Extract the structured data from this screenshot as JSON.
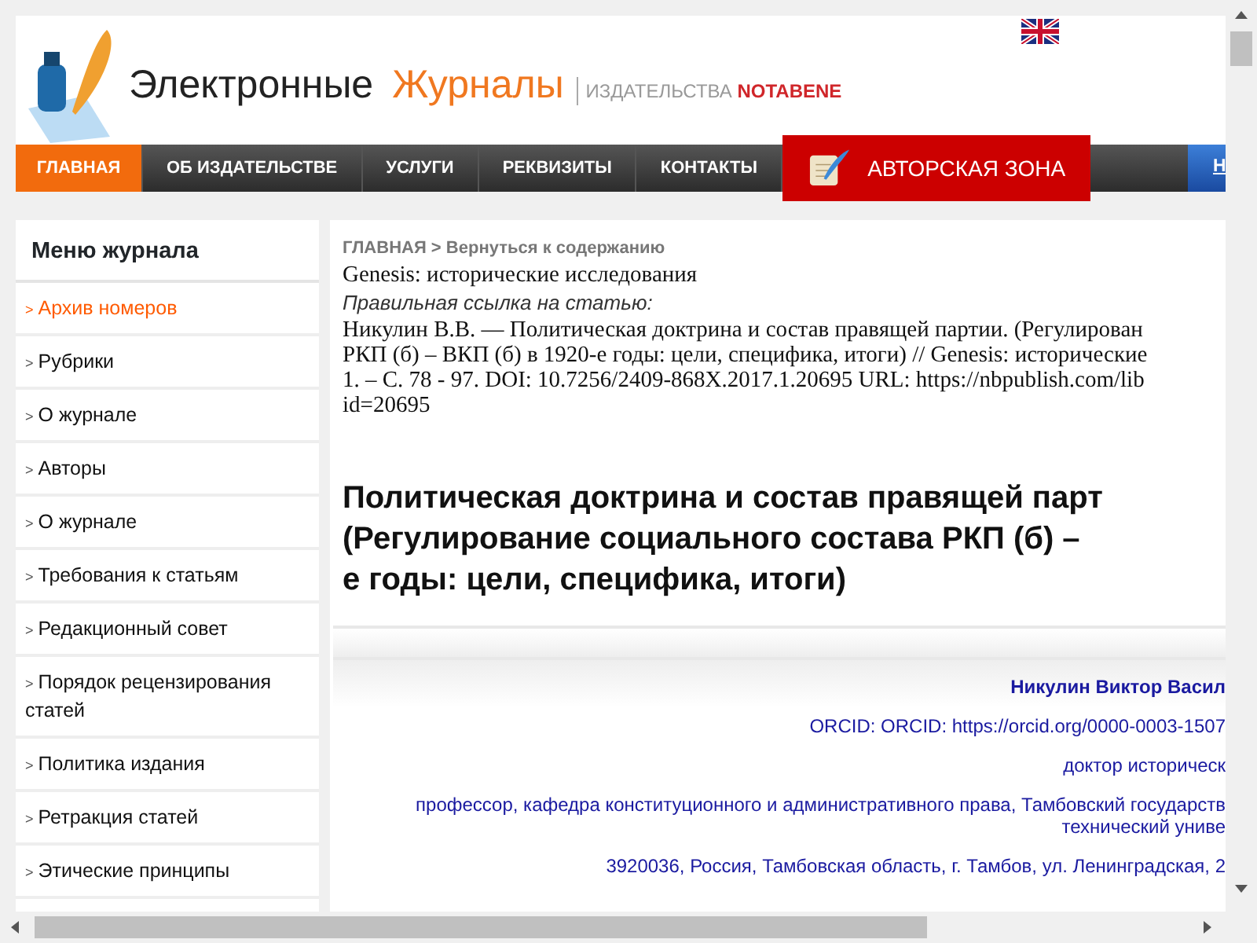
{
  "header": {
    "logo_title": "Электронные",
    "logo_accent": "Журналы",
    "publisher_prefix": "ИЗДАТЕЛЬСТВА",
    "publisher_name": "NOTABENE"
  },
  "nav": [
    {
      "label": "ГЛАВНАЯ",
      "kind": "link",
      "selected": true
    },
    {
      "label": "ОБ ИЗДАТЕЛЬСТВЕ",
      "kind": "link",
      "selected": false
    },
    {
      "label": "УСЛУГИ",
      "kind": "link",
      "selected": false
    },
    {
      "label": "РЕКВИЗИТЫ",
      "kind": "link",
      "selected": false
    },
    {
      "label": "КОНТАКТЫ",
      "kind": "link",
      "selected": false
    },
    {
      "label": "АВТОРСКАЯ ЗОНА",
      "kind": "author",
      "selected": false
    },
    {
      "label": "Н",
      "kind": "blue",
      "selected": false
    }
  ],
  "sidebar": {
    "title": "Меню журнала",
    "items": [
      {
        "marker": ">",
        "label": "Архив номеров",
        "selected": true
      },
      {
        "marker": ">",
        "label": "Рубрики",
        "selected": false
      },
      {
        "marker": ">",
        "label": "О журнале",
        "selected": false
      },
      {
        "marker": ">",
        "label": "Авторы",
        "selected": false
      },
      {
        "marker": ">",
        "label": "О журнале",
        "selected": false
      },
      {
        "marker": ">",
        "label": "Требования к статьям",
        "selected": false
      },
      {
        "marker": ">",
        "label": "Редакционный совет",
        "selected": false
      },
      {
        "marker": ">",
        "label": "Порядок рецензирования статей",
        "selected": false
      },
      {
        "marker": ">",
        "label": "Политика издания",
        "selected": false
      },
      {
        "marker": ">",
        "label": "Ретракция статей",
        "selected": false
      },
      {
        "marker": ">",
        "label": "Этические принципы",
        "selected": false
      }
    ]
  },
  "breadcrumb": {
    "home": "ГЛАВНАЯ",
    "separator": ">",
    "back": "Вернуться к содержанию"
  },
  "journal": "Genesis: исторические исследования",
  "citation_label": "Правильная ссылка на статью:",
  "citation_lines": [
    "Никулин В.В. — Политическая доктрина и состав правящей партии. (Регулирован",
    "РКП (б) – ВКП (б) в 1920-е годы: цели, специфика, итоги) // Genesis: исторические",
    "1. – С. 78 - 97. DOI: 10.7256/2409-868X.2017.1.20695 URL: https://nbpublish.com/lib",
    "id=20695"
  ],
  "title_lines": [
    "Политическая доктрина и состав правящей парт",
    "(Регулирование социального состава РКП (б) –",
    "е годы: цели, специфика, итоги)"
  ],
  "author": {
    "name": "Никулин Виктор Васил",
    "orcid": "ORCID: ORCID: https://orcid.org/0000-0003-1507",
    "degree": "доктор историческ",
    "position_lines": [
      "профессор, кафедра конституционного и административного права, Тамбовский государств",
      "технический униве"
    ],
    "address": "3920036, Россия, Тамбовская область, г. Тамбов, ул. Ленинградская, 2"
  }
}
